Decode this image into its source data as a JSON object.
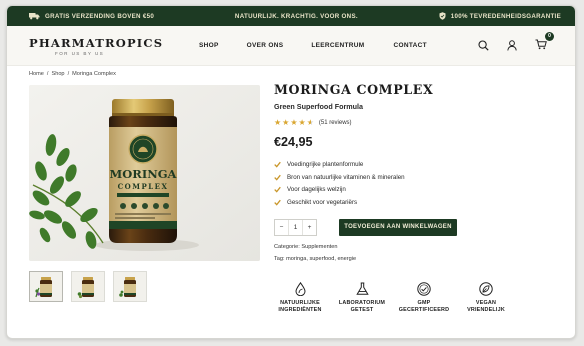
{
  "promo": {
    "shipping": "GRATIS VERZENDING BOVEN €50",
    "slogan": "NATUURLIJK. KRACHTIG. VOOR ONS.",
    "guarantee": "100% TEVREDENHEIDSGARANTIE"
  },
  "header": {
    "logo": "PHARMATROPICS",
    "logo_sub": "FOR US BY US",
    "nav": [
      "SHOP",
      "OVER ONS",
      "LEERCENTRUM",
      "CONTACT"
    ],
    "cart_count": "0"
  },
  "breadcrumb": [
    "Home",
    "/",
    "Shop",
    "/",
    "Moringa Complex"
  ],
  "product": {
    "title": "MORINGA COMPLEX",
    "subtitle": "Green Superfood Formula",
    "rating": 4.5,
    "reviews": "(51 reviews)",
    "price": "€24,95",
    "features": [
      "Voedingrijke plantenformule",
      "Bron van natuurlijke vitaminen & mineralen",
      "Voor dagelijks welzijn",
      "Geschikt voor vegetariërs"
    ],
    "qty_minus": "−",
    "qty_value": "1",
    "qty_plus": "+",
    "add_to_cart": "TOEVOEGEN AAN WINKELWAGEN",
    "category_label": "Categorie:",
    "category": "Supplementen",
    "tags_label": "Tag:",
    "tags": "moringa, superfood, energie",
    "label_brand": "MORINGA",
    "label_name": "COMPLEX"
  },
  "badges": [
    {
      "line1": "NATUURLIJKE",
      "line2": "INGREDIËNTEN",
      "icon": "drop-leaf-icon"
    },
    {
      "line1": "LABORATORIUM",
      "line2": "GETEST",
      "icon": "flask-icon"
    },
    {
      "line1": "GMP",
      "line2": "GECERTIFICEERD",
      "icon": "gmp-seal-icon"
    },
    {
      "line1": "VEGAN",
      "line2": "VRIENDELIJK",
      "icon": "vegan-leaf-icon"
    }
  ],
  "colors": {
    "brand_green": "#1d3a23",
    "gold": "#d9a630",
    "label_gold": "#cdb88a"
  }
}
